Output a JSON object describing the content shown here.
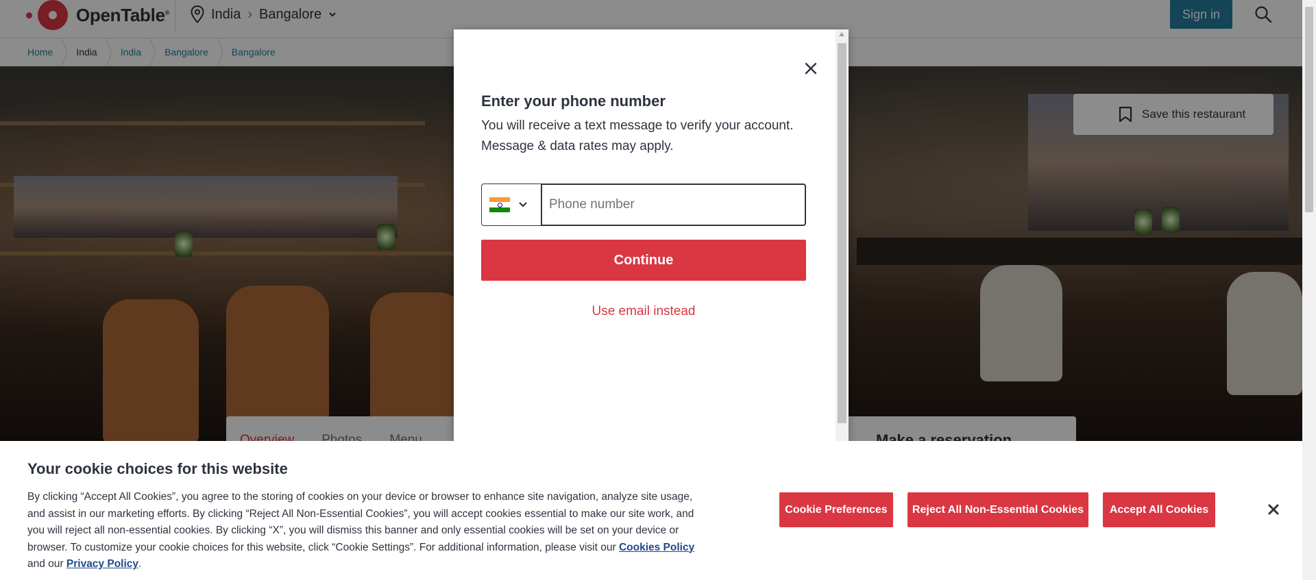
{
  "header": {
    "logo_text": "OpenTable",
    "location": {
      "country": "India",
      "city": "Bangalore"
    },
    "signin_label": "Sign in"
  },
  "breadcrumb": [
    "Home",
    "India",
    "India",
    "Bangalore",
    "Bangalore"
  ],
  "hero": {
    "save_label": "Save this restaurant",
    "tabs": [
      "Overview",
      "Photos",
      "Menu"
    ],
    "reserve_title": "Make a reservation"
  },
  "modal": {
    "title": "Enter your phone number",
    "desc_line1": "You will receive a text message to verify your account.",
    "desc_line2": "Message & data rates may apply.",
    "country_flag": "india-flag-icon",
    "phone_placeholder": "Phone number",
    "phone_value": "",
    "continue_label": "Continue",
    "email_link": "Use email instead"
  },
  "cookie": {
    "title": "Your cookie choices for this website",
    "text_before_link": "By clicking “Accept All Cookies”, you agree to the storing of cookies on your device or browser to enhance site navigation, analyze site usage, and assist in our marketing efforts. By clicking “Reject All Non-Essential Cookies”, you will accept cookies essential to make our site work, and you will reject all non-essential cookies. By clicking “X”, you will dismiss this banner and only essential cookies will be set on your device or browser. To customize your cookie choices for this website, click “Cookie Settings”. For additional information, please visit our",
    "cookies_policy_link": "Cookies Policy",
    "and_our": "and our",
    "privacy_policy_link": "Privacy Policy",
    "period": ".",
    "pref_label": "Cookie Preferences",
    "reject_label": "Reject All Non-Essential Cookies",
    "accept_label": "Accept All Cookies"
  },
  "colors": {
    "brand_red": "#da3743",
    "signin_blue": "#247f9e",
    "link_blue": "#1f4a8a"
  }
}
